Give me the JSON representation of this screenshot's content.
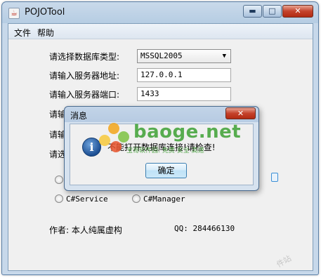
{
  "window": {
    "title": "POJOTool",
    "minimize_glyph": "▬",
    "maximize_glyph": "□",
    "close_glyph": "✕"
  },
  "menu": {
    "file": "文件",
    "help": "帮助"
  },
  "form": {
    "db_type_label": "请选择数据库类型:",
    "db_type_value": "MSSQL2005",
    "server_address_label": "请输入服务器地址:",
    "server_address_value": "127.0.0.1",
    "server_port_label": "请输入服务器端口:",
    "server_port_value": "1433",
    "row4_label": "请输",
    "row5_label": "请输",
    "row6_label": "请选"
  },
  "radios": {
    "csharp_service": "C#Service",
    "csharp_manager": "C#Manager"
  },
  "footer": {
    "author": "作者: 本人纯属虚构",
    "qq": "QQ: 284466130"
  },
  "dialog": {
    "title": "消息",
    "message": "不能打开数据库连接!请检查!",
    "ok_button": "确定",
    "info_glyph": "i"
  },
  "watermark": {
    "brand": "baoge.net",
    "tagline": "宝哥软件园: 免费 安全 高速",
    "corner_text": "件站"
  },
  "colors": {
    "titlebar": "#b6cde3",
    "close_button": "#c4422b",
    "watermark_green": "#3ca032",
    "dialog_background": "#f0f0f0"
  }
}
